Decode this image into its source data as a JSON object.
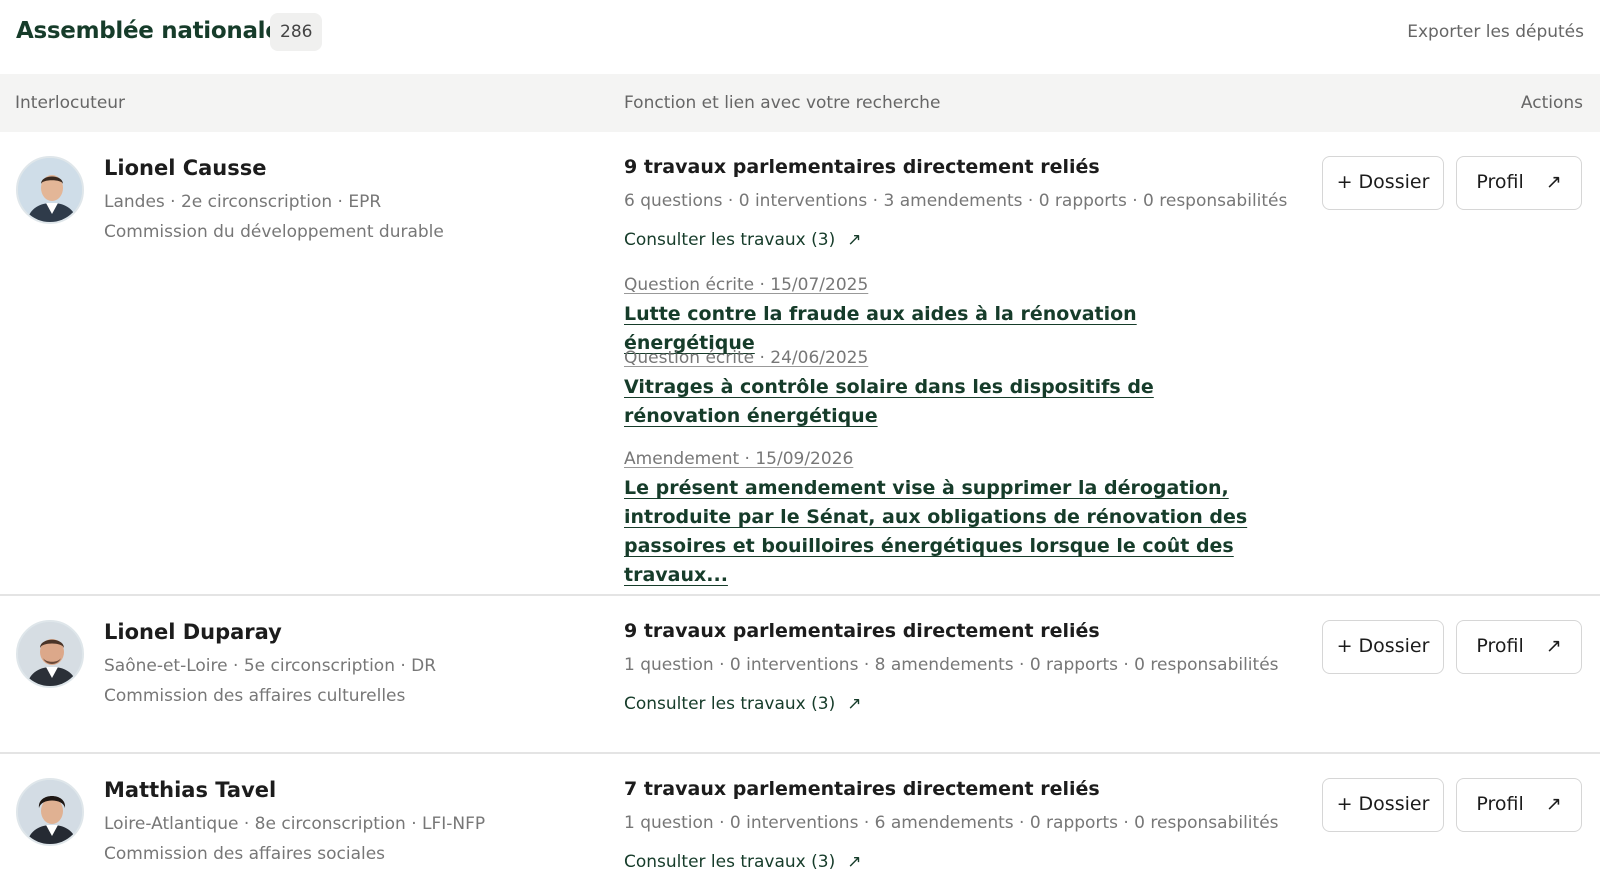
{
  "header": {
    "title": "Assemblée nationale",
    "count": "286",
    "export_label": "Exporter les députés"
  },
  "columns": {
    "interlocutor": "Interlocuteur",
    "function": "Fonction et lien avec votre recherche",
    "actions": "Actions"
  },
  "actions": {
    "dossier_label": "+ Dossier",
    "profile_label": "Profil"
  },
  "icons": {
    "external": "↗",
    "avatar": "person-avatar-icon"
  },
  "rows": [
    {
      "name": "Lionel Causse",
      "meta": "Landes · 2e circonscription · EPR",
      "commission": "Commission du développement durable",
      "works_title": "9 travaux parlementaires directement reliés",
      "stats": "6 questions · 0 interventions · 3 amendements · 0 rapports · 0 responsabilités",
      "consult": "Consulter les travaux (3)",
      "works": [
        {
          "type": "Question écrite · 15/07/2025",
          "title": "Lutte contre la fraude aux aides à la rénovation énergétique"
        },
        {
          "type": "Question écrite · 24/06/2025",
          "title": "Vitrages à contrôle solaire dans les dispositifs de rénovation énergétique"
        },
        {
          "type": "Amendement · 15/09/2026",
          "title": "Le présent amendement vise à supprimer la dérogation, introduite par le Sénat, aux obligations de rénovation des passoires et bouilloires énergétiques lorsque le coût des travaux..."
        }
      ]
    },
    {
      "name": "Lionel Duparay",
      "meta": "Saône-et-Loire · 5e circonscription · DR",
      "commission": "Commission des affaires culturelles",
      "works_title": "9 travaux parlementaires directement reliés",
      "stats": "1 question · 0 interventions · 8 amendements · 0 rapports · 0 responsabilités",
      "consult": "Consulter les travaux (3)"
    },
    {
      "name": "Matthias Tavel",
      "meta": "Loire-Atlantique · 8e circonscription · LFI-NFP",
      "commission": "Commission des affaires sociales",
      "works_title": "7 travaux parlementaires directement reliés",
      "stats": "1 question · 0 interventions · 6 amendements · 0 rapports · 0 responsabilités",
      "consult": "Consulter les travaux (3)"
    }
  ]
}
